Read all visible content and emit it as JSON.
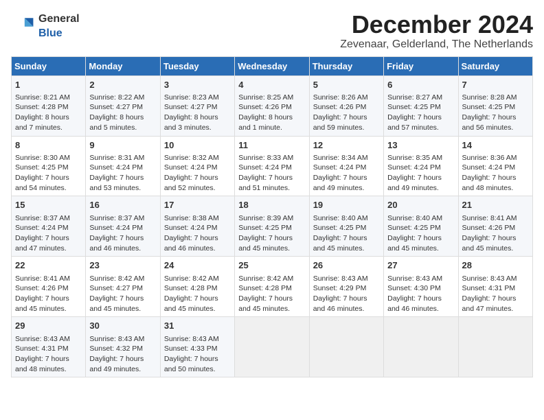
{
  "logo": {
    "general": "General",
    "blue": "Blue"
  },
  "title": "December 2024",
  "location": "Zevenaar, Gelderland, The Netherlands",
  "weekdays": [
    "Sunday",
    "Monday",
    "Tuesday",
    "Wednesday",
    "Thursday",
    "Friday",
    "Saturday"
  ],
  "weeks": [
    [
      {
        "day": "1",
        "sunrise": "Sunrise: 8:21 AM",
        "sunset": "Sunset: 4:28 PM",
        "daylight": "Daylight: 8 hours and 7 minutes."
      },
      {
        "day": "2",
        "sunrise": "Sunrise: 8:22 AM",
        "sunset": "Sunset: 4:27 PM",
        "daylight": "Daylight: 8 hours and 5 minutes."
      },
      {
        "day": "3",
        "sunrise": "Sunrise: 8:23 AM",
        "sunset": "Sunset: 4:27 PM",
        "daylight": "Daylight: 8 hours and 3 minutes."
      },
      {
        "day": "4",
        "sunrise": "Sunrise: 8:25 AM",
        "sunset": "Sunset: 4:26 PM",
        "daylight": "Daylight: 8 hours and 1 minute."
      },
      {
        "day": "5",
        "sunrise": "Sunrise: 8:26 AM",
        "sunset": "Sunset: 4:26 PM",
        "daylight": "Daylight: 7 hours and 59 minutes."
      },
      {
        "day": "6",
        "sunrise": "Sunrise: 8:27 AM",
        "sunset": "Sunset: 4:25 PM",
        "daylight": "Daylight: 7 hours and 57 minutes."
      },
      {
        "day": "7",
        "sunrise": "Sunrise: 8:28 AM",
        "sunset": "Sunset: 4:25 PM",
        "daylight": "Daylight: 7 hours and 56 minutes."
      }
    ],
    [
      {
        "day": "8",
        "sunrise": "Sunrise: 8:30 AM",
        "sunset": "Sunset: 4:25 PM",
        "daylight": "Daylight: 7 hours and 54 minutes."
      },
      {
        "day": "9",
        "sunrise": "Sunrise: 8:31 AM",
        "sunset": "Sunset: 4:24 PM",
        "daylight": "Daylight: 7 hours and 53 minutes."
      },
      {
        "day": "10",
        "sunrise": "Sunrise: 8:32 AM",
        "sunset": "Sunset: 4:24 PM",
        "daylight": "Daylight: 7 hours and 52 minutes."
      },
      {
        "day": "11",
        "sunrise": "Sunrise: 8:33 AM",
        "sunset": "Sunset: 4:24 PM",
        "daylight": "Daylight: 7 hours and 51 minutes."
      },
      {
        "day": "12",
        "sunrise": "Sunrise: 8:34 AM",
        "sunset": "Sunset: 4:24 PM",
        "daylight": "Daylight: 7 hours and 49 minutes."
      },
      {
        "day": "13",
        "sunrise": "Sunrise: 8:35 AM",
        "sunset": "Sunset: 4:24 PM",
        "daylight": "Daylight: 7 hours and 49 minutes."
      },
      {
        "day": "14",
        "sunrise": "Sunrise: 8:36 AM",
        "sunset": "Sunset: 4:24 PM",
        "daylight": "Daylight: 7 hours and 48 minutes."
      }
    ],
    [
      {
        "day": "15",
        "sunrise": "Sunrise: 8:37 AM",
        "sunset": "Sunset: 4:24 PM",
        "daylight": "Daylight: 7 hours and 47 minutes."
      },
      {
        "day": "16",
        "sunrise": "Sunrise: 8:37 AM",
        "sunset": "Sunset: 4:24 PM",
        "daylight": "Daylight: 7 hours and 46 minutes."
      },
      {
        "day": "17",
        "sunrise": "Sunrise: 8:38 AM",
        "sunset": "Sunset: 4:24 PM",
        "daylight": "Daylight: 7 hours and 46 minutes."
      },
      {
        "day": "18",
        "sunrise": "Sunrise: 8:39 AM",
        "sunset": "Sunset: 4:25 PM",
        "daylight": "Daylight: 7 hours and 45 minutes."
      },
      {
        "day": "19",
        "sunrise": "Sunrise: 8:40 AM",
        "sunset": "Sunset: 4:25 PM",
        "daylight": "Daylight: 7 hours and 45 minutes."
      },
      {
        "day": "20",
        "sunrise": "Sunrise: 8:40 AM",
        "sunset": "Sunset: 4:25 PM",
        "daylight": "Daylight: 7 hours and 45 minutes."
      },
      {
        "day": "21",
        "sunrise": "Sunrise: 8:41 AM",
        "sunset": "Sunset: 4:26 PM",
        "daylight": "Daylight: 7 hours and 45 minutes."
      }
    ],
    [
      {
        "day": "22",
        "sunrise": "Sunrise: 8:41 AM",
        "sunset": "Sunset: 4:26 PM",
        "daylight": "Daylight: 7 hours and 45 minutes."
      },
      {
        "day": "23",
        "sunrise": "Sunrise: 8:42 AM",
        "sunset": "Sunset: 4:27 PM",
        "daylight": "Daylight: 7 hours and 45 minutes."
      },
      {
        "day": "24",
        "sunrise": "Sunrise: 8:42 AM",
        "sunset": "Sunset: 4:28 PM",
        "daylight": "Daylight: 7 hours and 45 minutes."
      },
      {
        "day": "25",
        "sunrise": "Sunrise: 8:42 AM",
        "sunset": "Sunset: 4:28 PM",
        "daylight": "Daylight: 7 hours and 45 minutes."
      },
      {
        "day": "26",
        "sunrise": "Sunrise: 8:43 AM",
        "sunset": "Sunset: 4:29 PM",
        "daylight": "Daylight: 7 hours and 46 minutes."
      },
      {
        "day": "27",
        "sunrise": "Sunrise: 8:43 AM",
        "sunset": "Sunset: 4:30 PM",
        "daylight": "Daylight: 7 hours and 46 minutes."
      },
      {
        "day": "28",
        "sunrise": "Sunrise: 8:43 AM",
        "sunset": "Sunset: 4:31 PM",
        "daylight": "Daylight: 7 hours and 47 minutes."
      }
    ],
    [
      {
        "day": "29",
        "sunrise": "Sunrise: 8:43 AM",
        "sunset": "Sunset: 4:31 PM",
        "daylight": "Daylight: 7 hours and 48 minutes."
      },
      {
        "day": "30",
        "sunrise": "Sunrise: 8:43 AM",
        "sunset": "Sunset: 4:32 PM",
        "daylight": "Daylight: 7 hours and 49 minutes."
      },
      {
        "day": "31",
        "sunrise": "Sunrise: 8:43 AM",
        "sunset": "Sunset: 4:33 PM",
        "daylight": "Daylight: 7 hours and 50 minutes."
      },
      null,
      null,
      null,
      null
    ]
  ]
}
